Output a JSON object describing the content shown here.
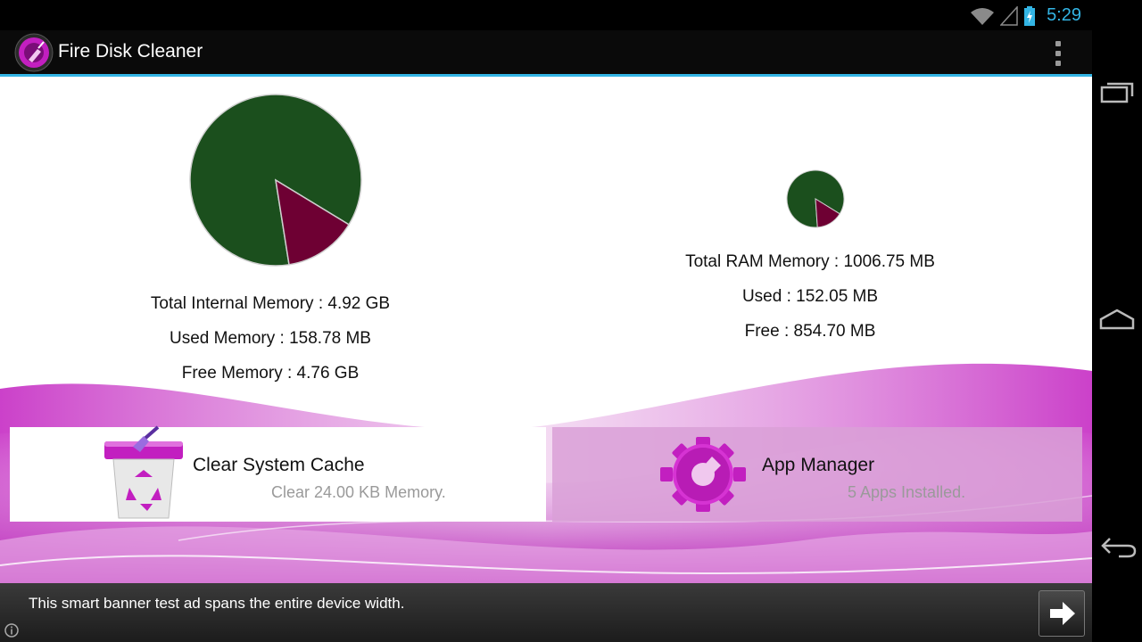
{
  "status_bar": {
    "time": "5:29",
    "icons": [
      "wifi-icon",
      "signal-icon",
      "battery-charging-icon"
    ]
  },
  "action_bar": {
    "title": "Fire Disk Cleaner",
    "app_icon": "broom-disc-icon",
    "menu_icon": "overflow-menu-icon"
  },
  "internal_memory": {
    "total_label": "Total Internal Memory : 4.92 GB",
    "used_label": "Used Memory : 158.78 MB",
    "free_label": "Free Memory : 4.76 GB"
  },
  "ram_memory": {
    "total_label": "Total RAM Memory : 1006.75 MB",
    "used_label": "Used : 152.05 MB",
    "free_label": "Free : 854.70 MB"
  },
  "chart_data": [
    {
      "type": "pie",
      "slices": [
        {
          "value": 0.862,
          "color": "#1b4f1d"
        },
        {
          "value": 0.138,
          "color": "#6e0033"
        }
      ]
    },
    {
      "type": "pie",
      "slices": [
        {
          "value": 0.849,
          "color": "#1b4f1d"
        },
        {
          "value": 0.151,
          "color": "#6e0033"
        }
      ]
    }
  ],
  "cards": {
    "clear_cache": {
      "title": "Clear System Cache",
      "subtitle": "Clear 24.00 KB Memory.",
      "icon": "recycle-trash-icon"
    },
    "app_manager": {
      "title": "App Manager",
      "subtitle": "5 Apps Installed.",
      "icon": "gear-icon"
    }
  },
  "ad": {
    "text": "This smart banner test ad spans the entire device width.",
    "arrow_icon": "arrow-right-icon",
    "info_icon": "info-icon"
  },
  "nav": {
    "recent_icon": "recent-apps-icon",
    "home_icon": "home-icon",
    "back_icon": "back-icon"
  },
  "colors": {
    "accent": "#33b5e5",
    "pie_free": "#1b4f1d",
    "pie_used": "#6e0033",
    "brand": "#c21fc0"
  }
}
